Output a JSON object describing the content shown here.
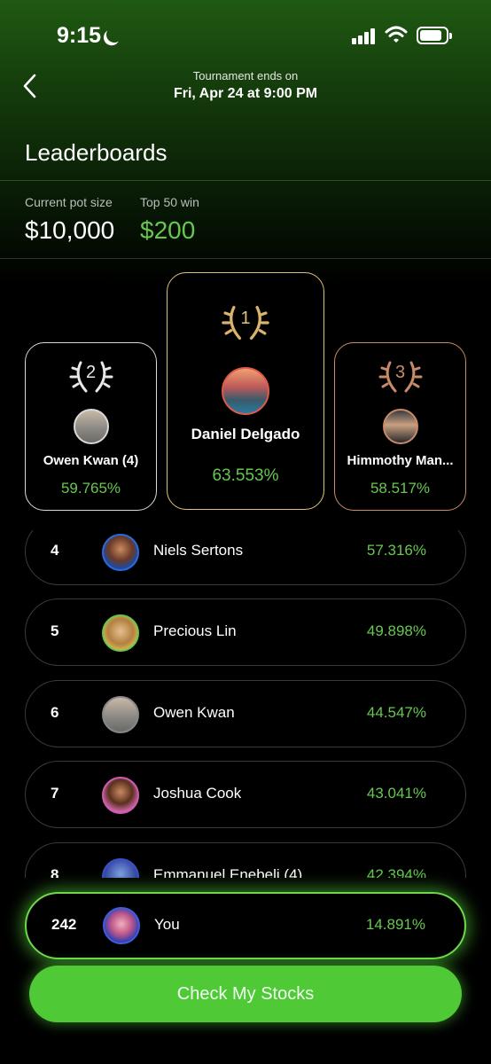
{
  "status_bar": {
    "time": "9:15"
  },
  "header": {
    "tournament_label": "Tournament ends on",
    "tournament_date": "Fri, Apr 24 at 9:00 PM",
    "title": "Leaderboards"
  },
  "pot": {
    "current_label": "Current pot size",
    "current_value": "$10,000",
    "top_label": "Top 50 win",
    "top_value": "$200"
  },
  "podium": {
    "first": {
      "rank": "1",
      "name": "Daniel Delgado",
      "pct": "63.553%"
    },
    "second": {
      "rank": "2",
      "name": "Owen Kwan (4)",
      "pct": "59.765%"
    },
    "third": {
      "rank": "3",
      "name": "Himmothy Man...",
      "pct": "58.517%"
    }
  },
  "rows": [
    {
      "rank": "4",
      "name": "Niels Sertons",
      "pct": "57.316%"
    },
    {
      "rank": "5",
      "name": "Precious  Lin",
      "pct": "49.898%"
    },
    {
      "rank": "6",
      "name": "Owen Kwan",
      "pct": "44.547%"
    },
    {
      "rank": "7",
      "name": "Joshua Cook",
      "pct": "43.041%"
    },
    {
      "rank": "8",
      "name": "Emmanuel Enebeli (4)",
      "pct": "42.394%"
    }
  ],
  "you": {
    "rank": "242",
    "name": "You",
    "pct": "14.891%"
  },
  "cta": {
    "label": "Check My Stocks"
  },
  "colors": {
    "accent_green": "#66c84f",
    "gold": "#e1c27a",
    "silver": "#d9d9d9",
    "bronze": "#c98a68"
  },
  "icons": [
    "moon-icon",
    "signal-icon",
    "wifi-icon",
    "battery-icon",
    "back-chevron-icon",
    "laurel-icon"
  ]
}
